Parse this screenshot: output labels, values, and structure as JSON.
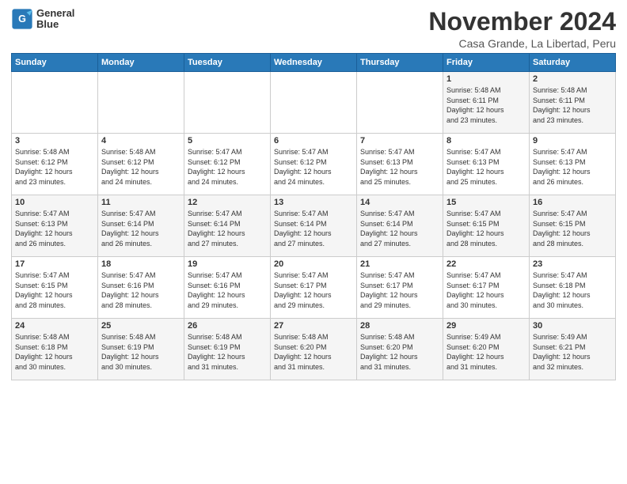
{
  "logo": {
    "line1": "General",
    "line2": "Blue"
  },
  "title": "November 2024",
  "location": "Casa Grande, La Libertad, Peru",
  "weekdays": [
    "Sunday",
    "Monday",
    "Tuesday",
    "Wednesday",
    "Thursday",
    "Friday",
    "Saturday"
  ],
  "weeks": [
    [
      {
        "day": "",
        "info": ""
      },
      {
        "day": "",
        "info": ""
      },
      {
        "day": "",
        "info": ""
      },
      {
        "day": "",
        "info": ""
      },
      {
        "day": "",
        "info": ""
      },
      {
        "day": "1",
        "info": "Sunrise: 5:48 AM\nSunset: 6:11 PM\nDaylight: 12 hours\nand 23 minutes."
      },
      {
        "day": "2",
        "info": "Sunrise: 5:48 AM\nSunset: 6:11 PM\nDaylight: 12 hours\nand 23 minutes."
      }
    ],
    [
      {
        "day": "3",
        "info": "Sunrise: 5:48 AM\nSunset: 6:12 PM\nDaylight: 12 hours\nand 23 minutes."
      },
      {
        "day": "4",
        "info": "Sunrise: 5:48 AM\nSunset: 6:12 PM\nDaylight: 12 hours\nand 24 minutes."
      },
      {
        "day": "5",
        "info": "Sunrise: 5:47 AM\nSunset: 6:12 PM\nDaylight: 12 hours\nand 24 minutes."
      },
      {
        "day": "6",
        "info": "Sunrise: 5:47 AM\nSunset: 6:12 PM\nDaylight: 12 hours\nand 24 minutes."
      },
      {
        "day": "7",
        "info": "Sunrise: 5:47 AM\nSunset: 6:13 PM\nDaylight: 12 hours\nand 25 minutes."
      },
      {
        "day": "8",
        "info": "Sunrise: 5:47 AM\nSunset: 6:13 PM\nDaylight: 12 hours\nand 25 minutes."
      },
      {
        "day": "9",
        "info": "Sunrise: 5:47 AM\nSunset: 6:13 PM\nDaylight: 12 hours\nand 26 minutes."
      }
    ],
    [
      {
        "day": "10",
        "info": "Sunrise: 5:47 AM\nSunset: 6:13 PM\nDaylight: 12 hours\nand 26 minutes."
      },
      {
        "day": "11",
        "info": "Sunrise: 5:47 AM\nSunset: 6:14 PM\nDaylight: 12 hours\nand 26 minutes."
      },
      {
        "day": "12",
        "info": "Sunrise: 5:47 AM\nSunset: 6:14 PM\nDaylight: 12 hours\nand 27 minutes."
      },
      {
        "day": "13",
        "info": "Sunrise: 5:47 AM\nSunset: 6:14 PM\nDaylight: 12 hours\nand 27 minutes."
      },
      {
        "day": "14",
        "info": "Sunrise: 5:47 AM\nSunset: 6:14 PM\nDaylight: 12 hours\nand 27 minutes."
      },
      {
        "day": "15",
        "info": "Sunrise: 5:47 AM\nSunset: 6:15 PM\nDaylight: 12 hours\nand 28 minutes."
      },
      {
        "day": "16",
        "info": "Sunrise: 5:47 AM\nSunset: 6:15 PM\nDaylight: 12 hours\nand 28 minutes."
      }
    ],
    [
      {
        "day": "17",
        "info": "Sunrise: 5:47 AM\nSunset: 6:15 PM\nDaylight: 12 hours\nand 28 minutes."
      },
      {
        "day": "18",
        "info": "Sunrise: 5:47 AM\nSunset: 6:16 PM\nDaylight: 12 hours\nand 28 minutes."
      },
      {
        "day": "19",
        "info": "Sunrise: 5:47 AM\nSunset: 6:16 PM\nDaylight: 12 hours\nand 29 minutes."
      },
      {
        "day": "20",
        "info": "Sunrise: 5:47 AM\nSunset: 6:17 PM\nDaylight: 12 hours\nand 29 minutes."
      },
      {
        "day": "21",
        "info": "Sunrise: 5:47 AM\nSunset: 6:17 PM\nDaylight: 12 hours\nand 29 minutes."
      },
      {
        "day": "22",
        "info": "Sunrise: 5:47 AM\nSunset: 6:17 PM\nDaylight: 12 hours\nand 30 minutes."
      },
      {
        "day": "23",
        "info": "Sunrise: 5:47 AM\nSunset: 6:18 PM\nDaylight: 12 hours\nand 30 minutes."
      }
    ],
    [
      {
        "day": "24",
        "info": "Sunrise: 5:48 AM\nSunset: 6:18 PM\nDaylight: 12 hours\nand 30 minutes."
      },
      {
        "day": "25",
        "info": "Sunrise: 5:48 AM\nSunset: 6:19 PM\nDaylight: 12 hours\nand 30 minutes."
      },
      {
        "day": "26",
        "info": "Sunrise: 5:48 AM\nSunset: 6:19 PM\nDaylight: 12 hours\nand 31 minutes."
      },
      {
        "day": "27",
        "info": "Sunrise: 5:48 AM\nSunset: 6:20 PM\nDaylight: 12 hours\nand 31 minutes."
      },
      {
        "day": "28",
        "info": "Sunrise: 5:48 AM\nSunset: 6:20 PM\nDaylight: 12 hours\nand 31 minutes."
      },
      {
        "day": "29",
        "info": "Sunrise: 5:49 AM\nSunset: 6:20 PM\nDaylight: 12 hours\nand 31 minutes."
      },
      {
        "day": "30",
        "info": "Sunrise: 5:49 AM\nSunset: 6:21 PM\nDaylight: 12 hours\nand 32 minutes."
      }
    ]
  ]
}
